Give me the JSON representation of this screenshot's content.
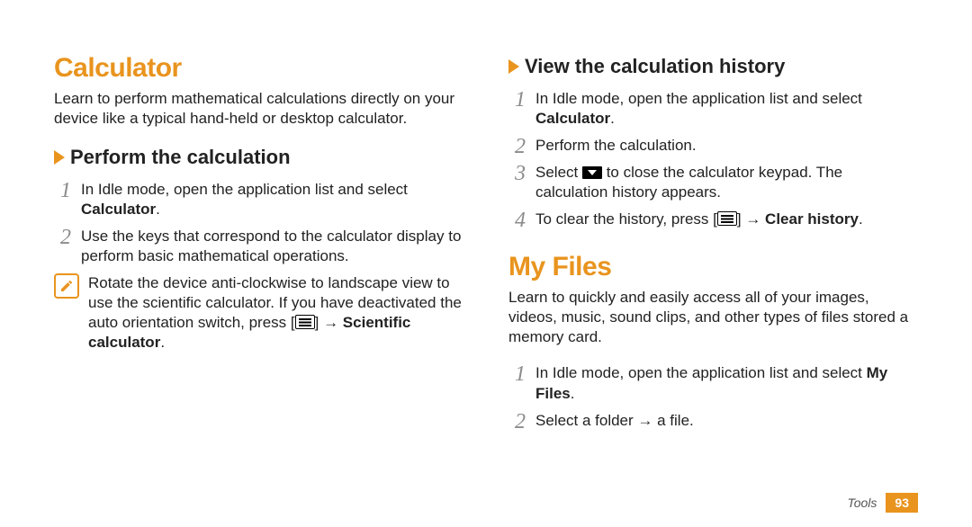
{
  "left": {
    "h1": "Calculator",
    "intro": "Learn to perform mathematical calculations directly on your device like a typical hand-held or desktop calculator.",
    "sec1_title": "Perform the calculation",
    "s1_1a": "In Idle mode, open the application list and select ",
    "s1_1b": "Calculator",
    "s1_1c": ".",
    "s1_2": "Use the keys that correspond to the calculator display to perform basic mathematical operations.",
    "note_a": "Rotate the device anti-clockwise to landscape view to use the scientific calculator. If you have deactivated the auto orientation switch, press [",
    "note_b": "] → ",
    "note_c": "Scientific calculator",
    "note_d": "."
  },
  "right": {
    "sec1_title": "View the calculation history",
    "r1_1a": "In Idle mode, open the application list and select ",
    "r1_1b": "Calculator",
    "r1_1c": ".",
    "r1_2": "Perform the calculation.",
    "r1_3a": "Select ",
    "r1_3b": " to close the calculator keypad. The calculation history appears.",
    "r1_4a": "To clear the history, press [",
    "r1_4b": "] → ",
    "r1_4c": "Clear history",
    "r1_4d": ".",
    "h2": "My Files",
    "intro2": "Learn to quickly and easily access all of your images, videos, music, sound clips, and other types of files stored a memory card.",
    "r2_1a": "In Idle mode, open the application list and select ",
    "r2_1b": "My Files",
    "r2_1c": ".",
    "r2_2": "Select a folder → a file."
  },
  "footer": {
    "section": "Tools",
    "page": "93"
  }
}
